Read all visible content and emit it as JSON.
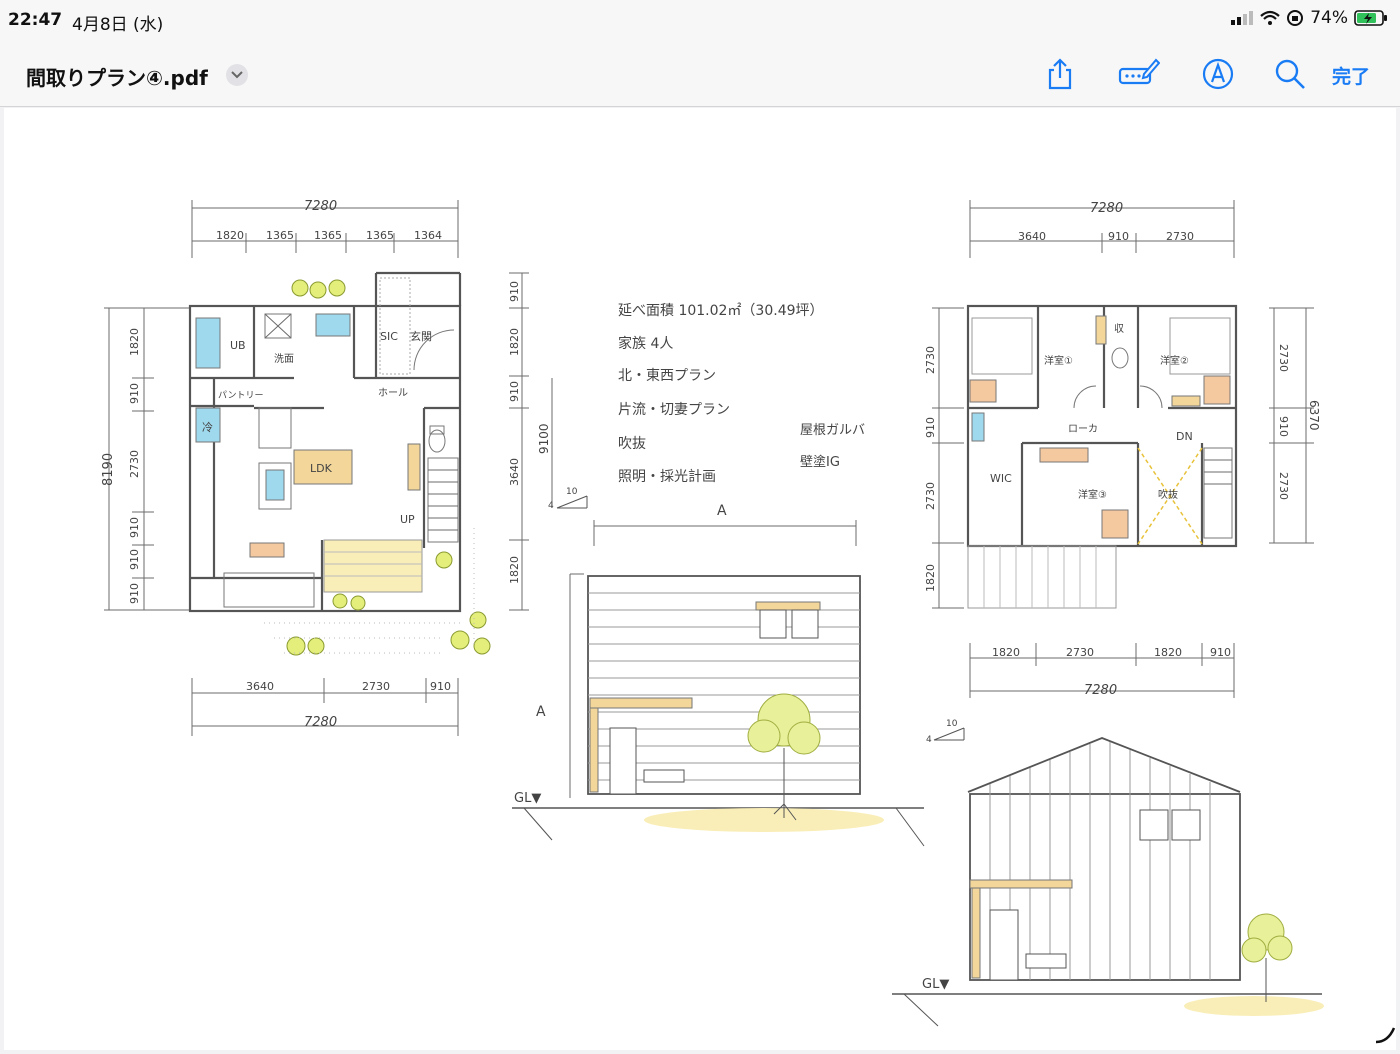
{
  "status": {
    "time": "22:47",
    "date": "4月8日 (水)",
    "battery": "74%"
  },
  "toolbar": {
    "title": "間取りプラン④.pdf",
    "done_label": "完了"
  },
  "icons": {
    "share": "share-icon",
    "markup": "markup-icon",
    "pencil": "pencil-circle-icon",
    "search": "search-icon",
    "chevron": "chevron-down-icon"
  },
  "colors": {
    "accent": "#1a7cf5",
    "wall": "#6b6b6b",
    "wood": "#f2d69a",
    "green": "#e3ef7a",
    "cyan": "#9fd9ee"
  },
  "drawing": {
    "plan1": {
      "top_total": "7280",
      "top_dims": [
        "1820",
        "1365",
        "1365",
        "1365",
        "1364"
      ],
      "bottom_dims": [
        "3640",
        "2730",
        "910"
      ],
      "bottom_total": "7280",
      "left_total": "8190",
      "left_dims": [
        "1820",
        "910",
        "2730",
        "910",
        "910",
        "910"
      ],
      "right_dims": [
        "910",
        "1820",
        "910",
        "3640",
        "1820"
      ],
      "right_total": "9100",
      "rooms": {
        "ub": "UB",
        "wash": "洗面",
        "pantry": "パントリー",
        "sic": "SIC",
        "genkan": "玄関",
        "hall": "ホール",
        "ldk": "LDK",
        "up": "UP",
        "fridge": "冷"
      }
    },
    "notes": [
      "延べ面積 101.02㎡（30.49坪）",
      "家族 4人",
      "北・東西プラン",
      "片流・切妻プラン",
      "吹抜",
      "照明・採光計画"
    ],
    "notes_right": [
      "屋根ガルバ",
      "壁塗IG"
    ],
    "elev1": {
      "section_mark": "A",
      "left_mark": "A",
      "gl": "GL▼",
      "slope": "10",
      "slope_small": "4"
    },
    "plan2": {
      "top_total": "7280",
      "top_dims": [
        "3640",
        "910",
        "2730"
      ],
      "bottom_dims": [
        "1820",
        "2730",
        "1820",
        "910"
      ],
      "bottom_total": "7280",
      "left_dims": [
        "2730",
        "910",
        "2730",
        "1820"
      ],
      "right_dims": [
        "2730",
        "910",
        "2730"
      ],
      "right_total": "6370",
      "rooms": {
        "r1": "洋室①",
        "r2": "洋室②",
        "r3": "洋室③",
        "storage": "収",
        "wic": "WIC",
        "corridor": "ローカ",
        "void": "吹抜",
        "dn": "DN"
      }
    },
    "elev2": {
      "gl": "GL▼",
      "slope": "10",
      "slope_small": "4"
    }
  }
}
